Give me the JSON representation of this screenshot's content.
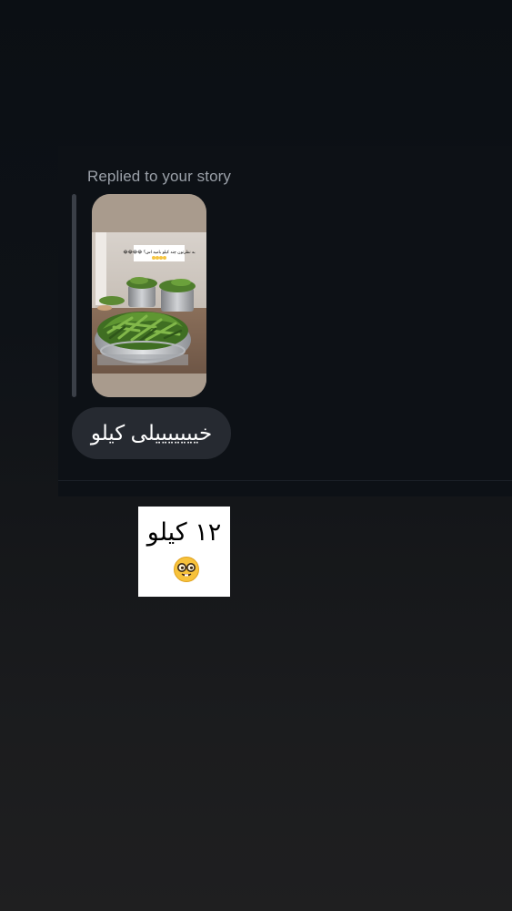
{
  "story_reply": {
    "label": "Replied to your story",
    "story_caption": "به نظرتون چند کیلو بامیه اس؟ 😂😂😂😂"
  },
  "incoming_message": {
    "text": "خیییییییلی کیلو"
  },
  "outgoing_message": {
    "text": "۱۲ کیلو",
    "emoji": "nerd-face-icon"
  },
  "colors": {
    "background_top": "#0b0f14",
    "background_bottom": "#1f1f20",
    "bubble": "#262a31",
    "label": "#9aa0a8"
  }
}
